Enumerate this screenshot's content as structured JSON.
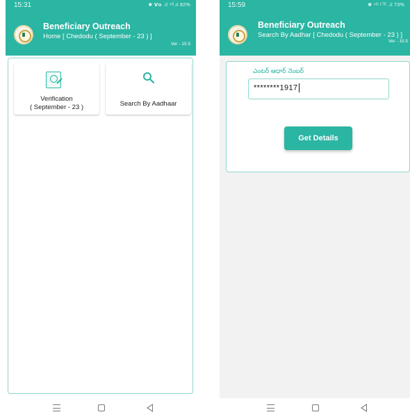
{
  "left_screen": {
    "status_time": "15:31",
    "status_icons": "✱ 𝗩𝗼 .ıl ⁴ᴳ.ıl 82%",
    "app_title": "Beneficiary Outreach",
    "subtitle": "Home [ Chedodu ( September - 23 ) ]",
    "version": "Ver - 15.5",
    "tiles": [
      {
        "label_line1": "Verification",
        "label_line2": "( September - 23 )",
        "icon": "document-person-icon"
      },
      {
        "label": "Search By Aadhaar",
        "icon": "search-icon"
      }
    ]
  },
  "right_screen": {
    "status_time": "15:59",
    "status_icons": "✱ ⁴ᴳ ᴸᵀᴱ .ıl 73%",
    "app_title": "Beneficiary Outreach",
    "subtitle": "Search By Aadhar [ Chedodu ( September - 23 ) ]",
    "version": "Ver - 15.5",
    "field_label": "ఎంటర్ ఆధార్ నెంబర్",
    "aadhar_value": "********1917",
    "button_label": "Get Details"
  },
  "colors": {
    "primary": "#2bb5a3",
    "frame_border": "#8ed6cd",
    "background_right": "#f2f2f2"
  }
}
